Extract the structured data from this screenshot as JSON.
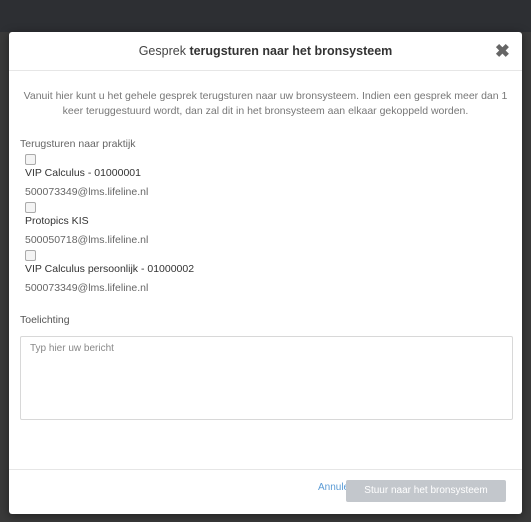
{
  "dialog": {
    "title_prefix": "Gesprek",
    "title_bold": "terugsturen naar het bronsysteem",
    "close_symbol": "✖",
    "intro": "Vanuit hier kunt u het gehele gesprek terugsturen naar uw bronsysteem. Indien een gesprek meer dan 1 keer teruggestuurd wordt, dan zal dit in het bronsysteem aan elkaar gekoppeld worden.",
    "section_label": "Terugsturen naar praktijk",
    "practices": [
      {
        "name": "VIP Calculus - 01000001",
        "email": "500073349@lms.lifeline.nl",
        "checked": false
      },
      {
        "name": "Protopics KIS",
        "email": "500050718@lms.lifeline.nl",
        "checked": false
      },
      {
        "name": "VIP Calculus persoonlijk - 01000002",
        "email": "500073349@lms.lifeline.nl",
        "checked": false
      }
    ],
    "note_label": "Toelichting",
    "note_placeholder": "Typ hier uw bericht",
    "cancel_label": "Annuleer",
    "submit_label": "Stuur naar het bronsysteem"
  },
  "colors": {
    "backdrop": "#3a3a3a",
    "link": "#5b9bd5",
    "submit_disabled": "#c3c7cc"
  }
}
